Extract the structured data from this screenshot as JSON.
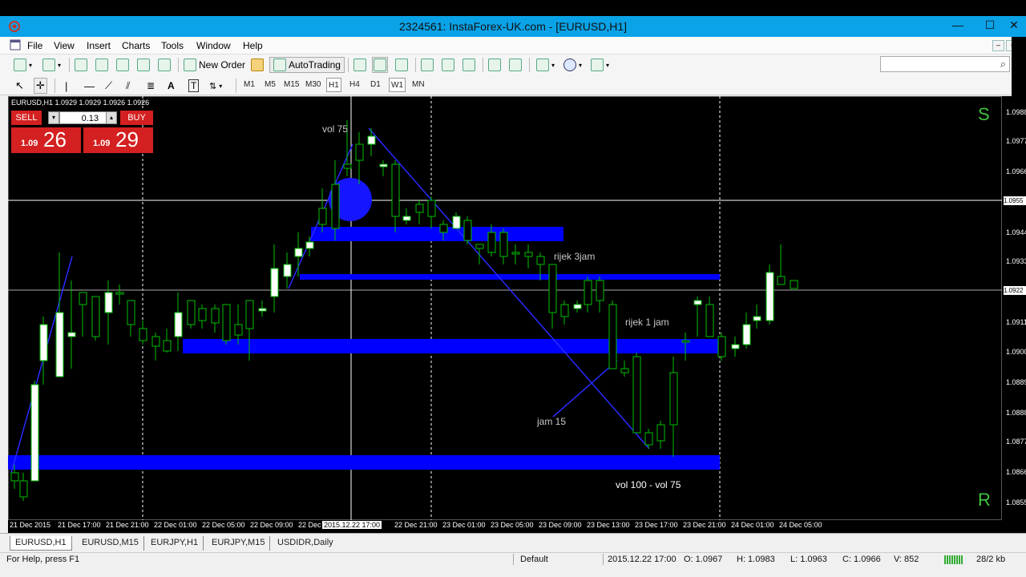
{
  "window": {
    "title": "2324561: InstaForex-UK.com - [EURUSD,H1]",
    "minimize": "—",
    "maximize": "☐",
    "close": "✕"
  },
  "menu": [
    "File",
    "View",
    "Insert",
    "Charts",
    "Tools",
    "Window",
    "Help"
  ],
  "toolbar": {
    "new_order": "New Order",
    "auto_trading": "AutoTrading"
  },
  "timeframes": [
    "M1",
    "M5",
    "M15",
    "M30",
    "H1",
    "H4",
    "D1",
    "W1",
    "MN"
  ],
  "active_timeframe": "H1",
  "search": {
    "placeholder": ""
  },
  "chart": {
    "header": "EURUSD,H1  1.0929 1.0929 1.0926 1.0926",
    "one_click": {
      "sell_label": "SELL",
      "buy_label": "BUY",
      "lot": "0.13",
      "sell_prefix": "1.09",
      "sell_big": "26",
      "buy_prefix": "1.09",
      "buy_big": "29"
    },
    "labels": {
      "vol75": "vol 75",
      "rijek3": "rijek 3jam",
      "rijek1": "rijek 1 jam",
      "jam15": "jam 15",
      "vol100": "vol 100 - vol 75",
      "S": "S",
      "R": "R"
    },
    "x_labels": [
      "21 Dec 2015",
      "21 Dec 17:00",
      "21 Dec 21:00",
      "22 Dec 01:00",
      "22 Dec 05:00",
      "22 Dec 09:00",
      "22 Dec",
      "2015.12.22 17:00",
      "22 Dec 21:00",
      "23 Dec 01:00",
      "23 Dec 05:00",
      "23 Dec 09:00",
      "23 Dec 13:00",
      "23 Dec 17:00",
      "23 Dec 21:00",
      "24 Dec 01:00",
      "24 Dec 05:00"
    ],
    "y_labels": [
      "1.0988",
      "1.0977",
      "1.0966",
      "1.0955",
      "1.0944",
      "1.0933",
      "1.0922",
      "1.0911",
      "1.0900",
      "1.0889",
      "1.0888",
      "1.0877",
      "1.0866",
      "1.0855"
    ],
    "highlight_price": "1.0955",
    "current_price": "1.0922",
    "colors": {
      "bull": "#ffffff",
      "bear": "#000000",
      "wick": "#00c000",
      "zone": "#0000ff",
      "bg": "#000000",
      "sr": "#3dc43d"
    }
  },
  "tabs": [
    "EURUSD,H1",
    "EURUSD,M15",
    "EURJPY,H1",
    "EURJPY,M15",
    "USDIDR,Daily"
  ],
  "active_tab": "EURUSD,H1",
  "status": {
    "help": "For Help, press F1",
    "profile": "Default",
    "datetime": "2015.12.22 17:00",
    "open": "O: 1.0967",
    "high": "H: 1.0983",
    "low": "L: 1.0963",
    "close": "C: 1.0966",
    "volume": "V: 852",
    "traffic": "28/2 kb"
  }
}
